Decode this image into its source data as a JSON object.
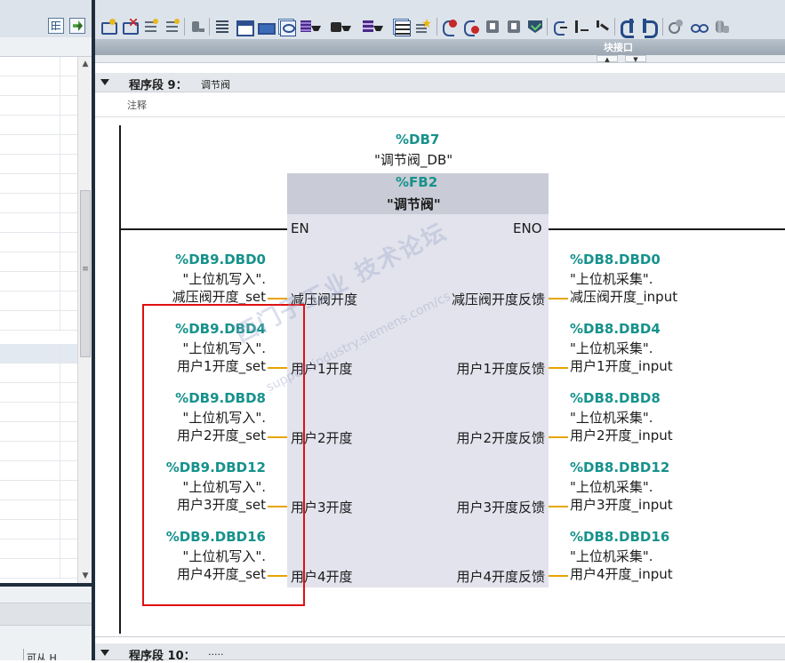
{
  "editor": {
    "block_interface_label": "块接口",
    "network9": {
      "title": "程序段 9：",
      "name": "调节阀",
      "comment": "注释"
    },
    "network10": {
      "title": "程序段 10：",
      "name": "....."
    }
  },
  "left_bottom": {
    "cell_label": "可从 H"
  },
  "fb_call": {
    "instance_db_addr": "%DB7",
    "instance_db_name": "\"调节阀_DB\"",
    "fb_addr": "%FB2",
    "fb_name": "\"调节阀\"",
    "en": "EN",
    "eno": "ENO",
    "inputs": [
      {
        "pin": "减压阀开度",
        "addr": "%DB9.DBD0",
        "db": "\"上位机写入\".",
        "tag": "减压阀开度_set"
      },
      {
        "pin": "用户1开度",
        "addr": "%DB9.DBD4",
        "db": "\"上位机写入\".",
        "tag": "用户1开度_set"
      },
      {
        "pin": "用户2开度",
        "addr": "%DB9.DBD8",
        "db": "\"上位机写入\".",
        "tag": "用户2开度_set"
      },
      {
        "pin": "用户3开度",
        "addr": "%DB9.DBD12",
        "db": "\"上位机写入\".",
        "tag": "用户3开度_set"
      },
      {
        "pin": "用户4开度",
        "addr": "%DB9.DBD16",
        "db": "\"上位机写入\".",
        "tag": "用户4开度_set"
      }
    ],
    "outputs": [
      {
        "pin": "减压阀开度反馈",
        "addr": "%DB8.DBD0",
        "db": "\"上位机采集\".",
        "tag": "减压阀开度_input"
      },
      {
        "pin": "用户1开度反馈",
        "addr": "%DB8.DBD4",
        "db": "\"上位机采集\".",
        "tag": "用户1开度_input"
      },
      {
        "pin": "用户2开度反馈",
        "addr": "%DB8.DBD8",
        "db": "\"上位机采集\".",
        "tag": "用户2开度_input"
      },
      {
        "pin": "用户3开度反馈",
        "addr": "%DB8.DBD12",
        "db": "\"上位机采集\".",
        "tag": "用户3开度_input"
      },
      {
        "pin": "用户4开度反馈",
        "addr": "%DB8.DBD16",
        "db": "\"上位机采集\".",
        "tag": "用户4开度_input"
      }
    ]
  },
  "watermark": {
    "text": "西门子工业  技术论坛",
    "url": "support.industry.siemens.com/cs"
  },
  "colors": {
    "address_teal": "#16928c",
    "pin_wire": "#e8a400",
    "highlight_red": "#e01010",
    "fb_header": "#c9ccd6",
    "fb_body": "#e2e3ec"
  },
  "icons": {
    "left_toolbar": [
      "grid-icon",
      "export-icon"
    ],
    "editor_toolbar": [
      "insert-network-icon",
      "delete-network-icon",
      "insert-row-icon",
      "add-row-icon",
      "connect-icon",
      "list-icon",
      "absolute-operand-icon",
      "window-icon",
      "comment-icon",
      "db-symbolic-icon",
      "db-absolute-icon",
      "db-both-icon",
      "operand-list-icon",
      "favorites-icon",
      "close-branch-icon",
      "delete-branch-icon",
      "monitor-icon",
      "check-icon",
      "open-branch-icon",
      "insert-line-icon",
      "diagonal-line-icon",
      "jump-previous-icon",
      "jump-next-icon",
      "settings-icon",
      "monitor-on-icon",
      "simulate-icon"
    ]
  }
}
